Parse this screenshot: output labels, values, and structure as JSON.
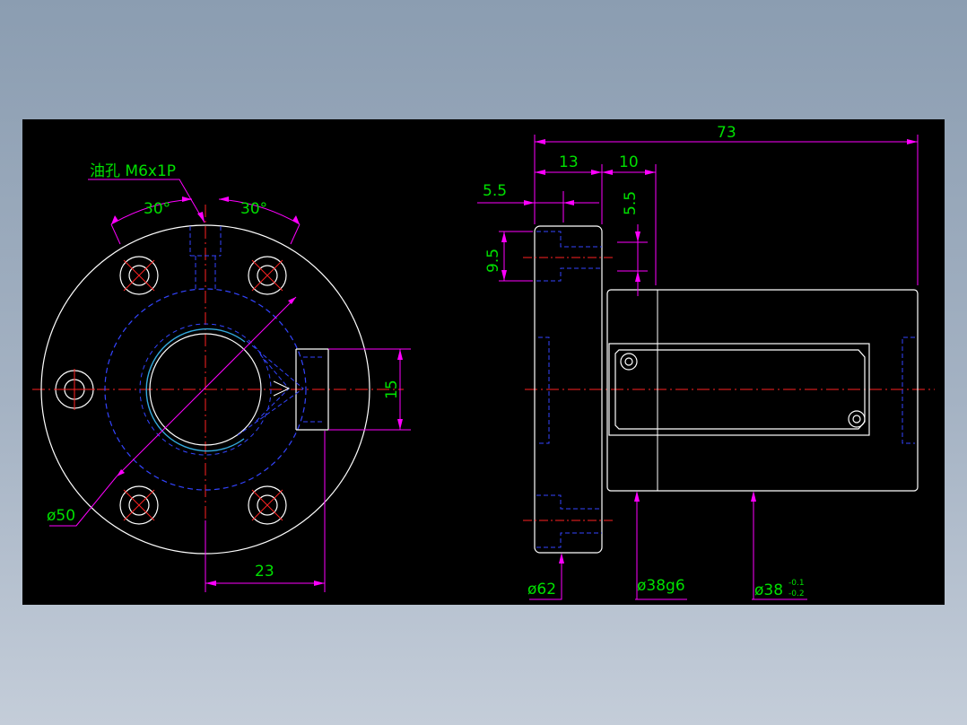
{
  "colors": {
    "background": "#000000",
    "outline": "#ffffff",
    "hidden_line": "#3344ff",
    "center_line": "#ff2222",
    "dimension": "#ff00ff",
    "dimension_text": "#00e000",
    "thread_arc": "#33aadd"
  },
  "annotations": {
    "oil_hole": "油孔 M6x1P",
    "angle_left": "30°",
    "angle_right": "30°",
    "dia_bolt_circle": "ø50",
    "dim_23": "23",
    "dim_15": "15",
    "dim_73": "73",
    "dim_13": "13",
    "dim_10": "10",
    "dim_5_5_left": "5.5",
    "dim_5_5_vertical": "5.5",
    "dim_9_5": "9.5",
    "dia_62": "ø62",
    "dia_38g6": "ø38g6",
    "dia_38_base": "ø38",
    "tol_upper": "-0.1",
    "tol_lower": "-0.2"
  }
}
